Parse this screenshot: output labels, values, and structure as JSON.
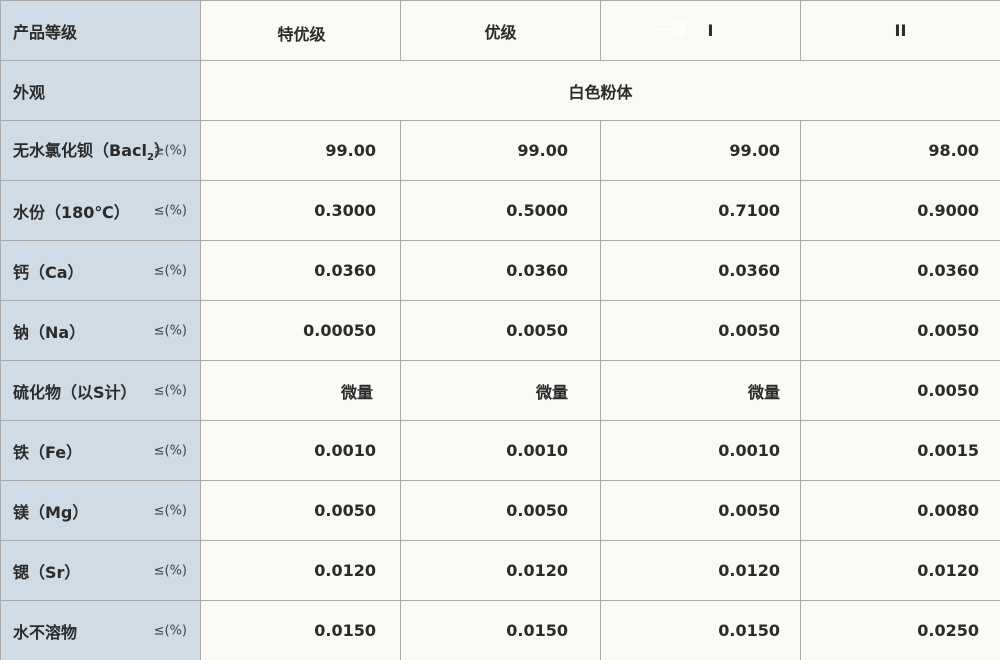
{
  "header": {
    "row_label": "产品等级",
    "grades": [
      "特优级",
      "优级",
      "I",
      "II"
    ],
    "grade3_ghost": "一等"
  },
  "appearance": {
    "label": "外观",
    "value": "白色粉体"
  },
  "rows": [
    {
      "name": "无水氯化钡（Bacl",
      "sub": "2",
      "name_tail": "）",
      "unit": "≥(%)",
      "values": [
        "99.00",
        "99.00",
        "99.00",
        "98.00"
      ]
    },
    {
      "name": "水份（180℃）",
      "unit": "≤(%)",
      "values": [
        "0.3000",
        "0.5000",
        "0.7100",
        "0.9000"
      ]
    },
    {
      "name": "钙（Ca）",
      "unit": "≤(%)",
      "values": [
        "0.0360",
        "0.0360",
        "0.0360",
        "0.0360"
      ]
    },
    {
      "name": "钠（Na）",
      "unit": "≤(%)",
      "values": [
        "0.00050",
        "0.0050",
        "0.0050",
        "0.0050"
      ]
    },
    {
      "name": "硫化物（以S计）",
      "unit": "≤(%)",
      "values": [
        "微量",
        "微量",
        "微量",
        "0.0050"
      ]
    },
    {
      "name": "铁（Fe）",
      "unit": "≤(%)",
      "values": [
        "0.0010",
        "0.0010",
        "0.0010",
        "0.0015"
      ]
    },
    {
      "name": "镁（Mg）",
      "unit": "≤(%)",
      "values": [
        "0.0050",
        "0.0050",
        "0.0050",
        "0.0080"
      ]
    },
    {
      "name": "锶（Sr）",
      "unit": "≤(%)",
      "values": [
        "0.0120",
        "0.0120",
        "0.0120",
        "0.0120"
      ]
    },
    {
      "name": "水不溶物",
      "unit": "≤(%)",
      "values": [
        "0.0150",
        "0.0150",
        "0.0150",
        "0.0250"
      ]
    }
  ]
}
